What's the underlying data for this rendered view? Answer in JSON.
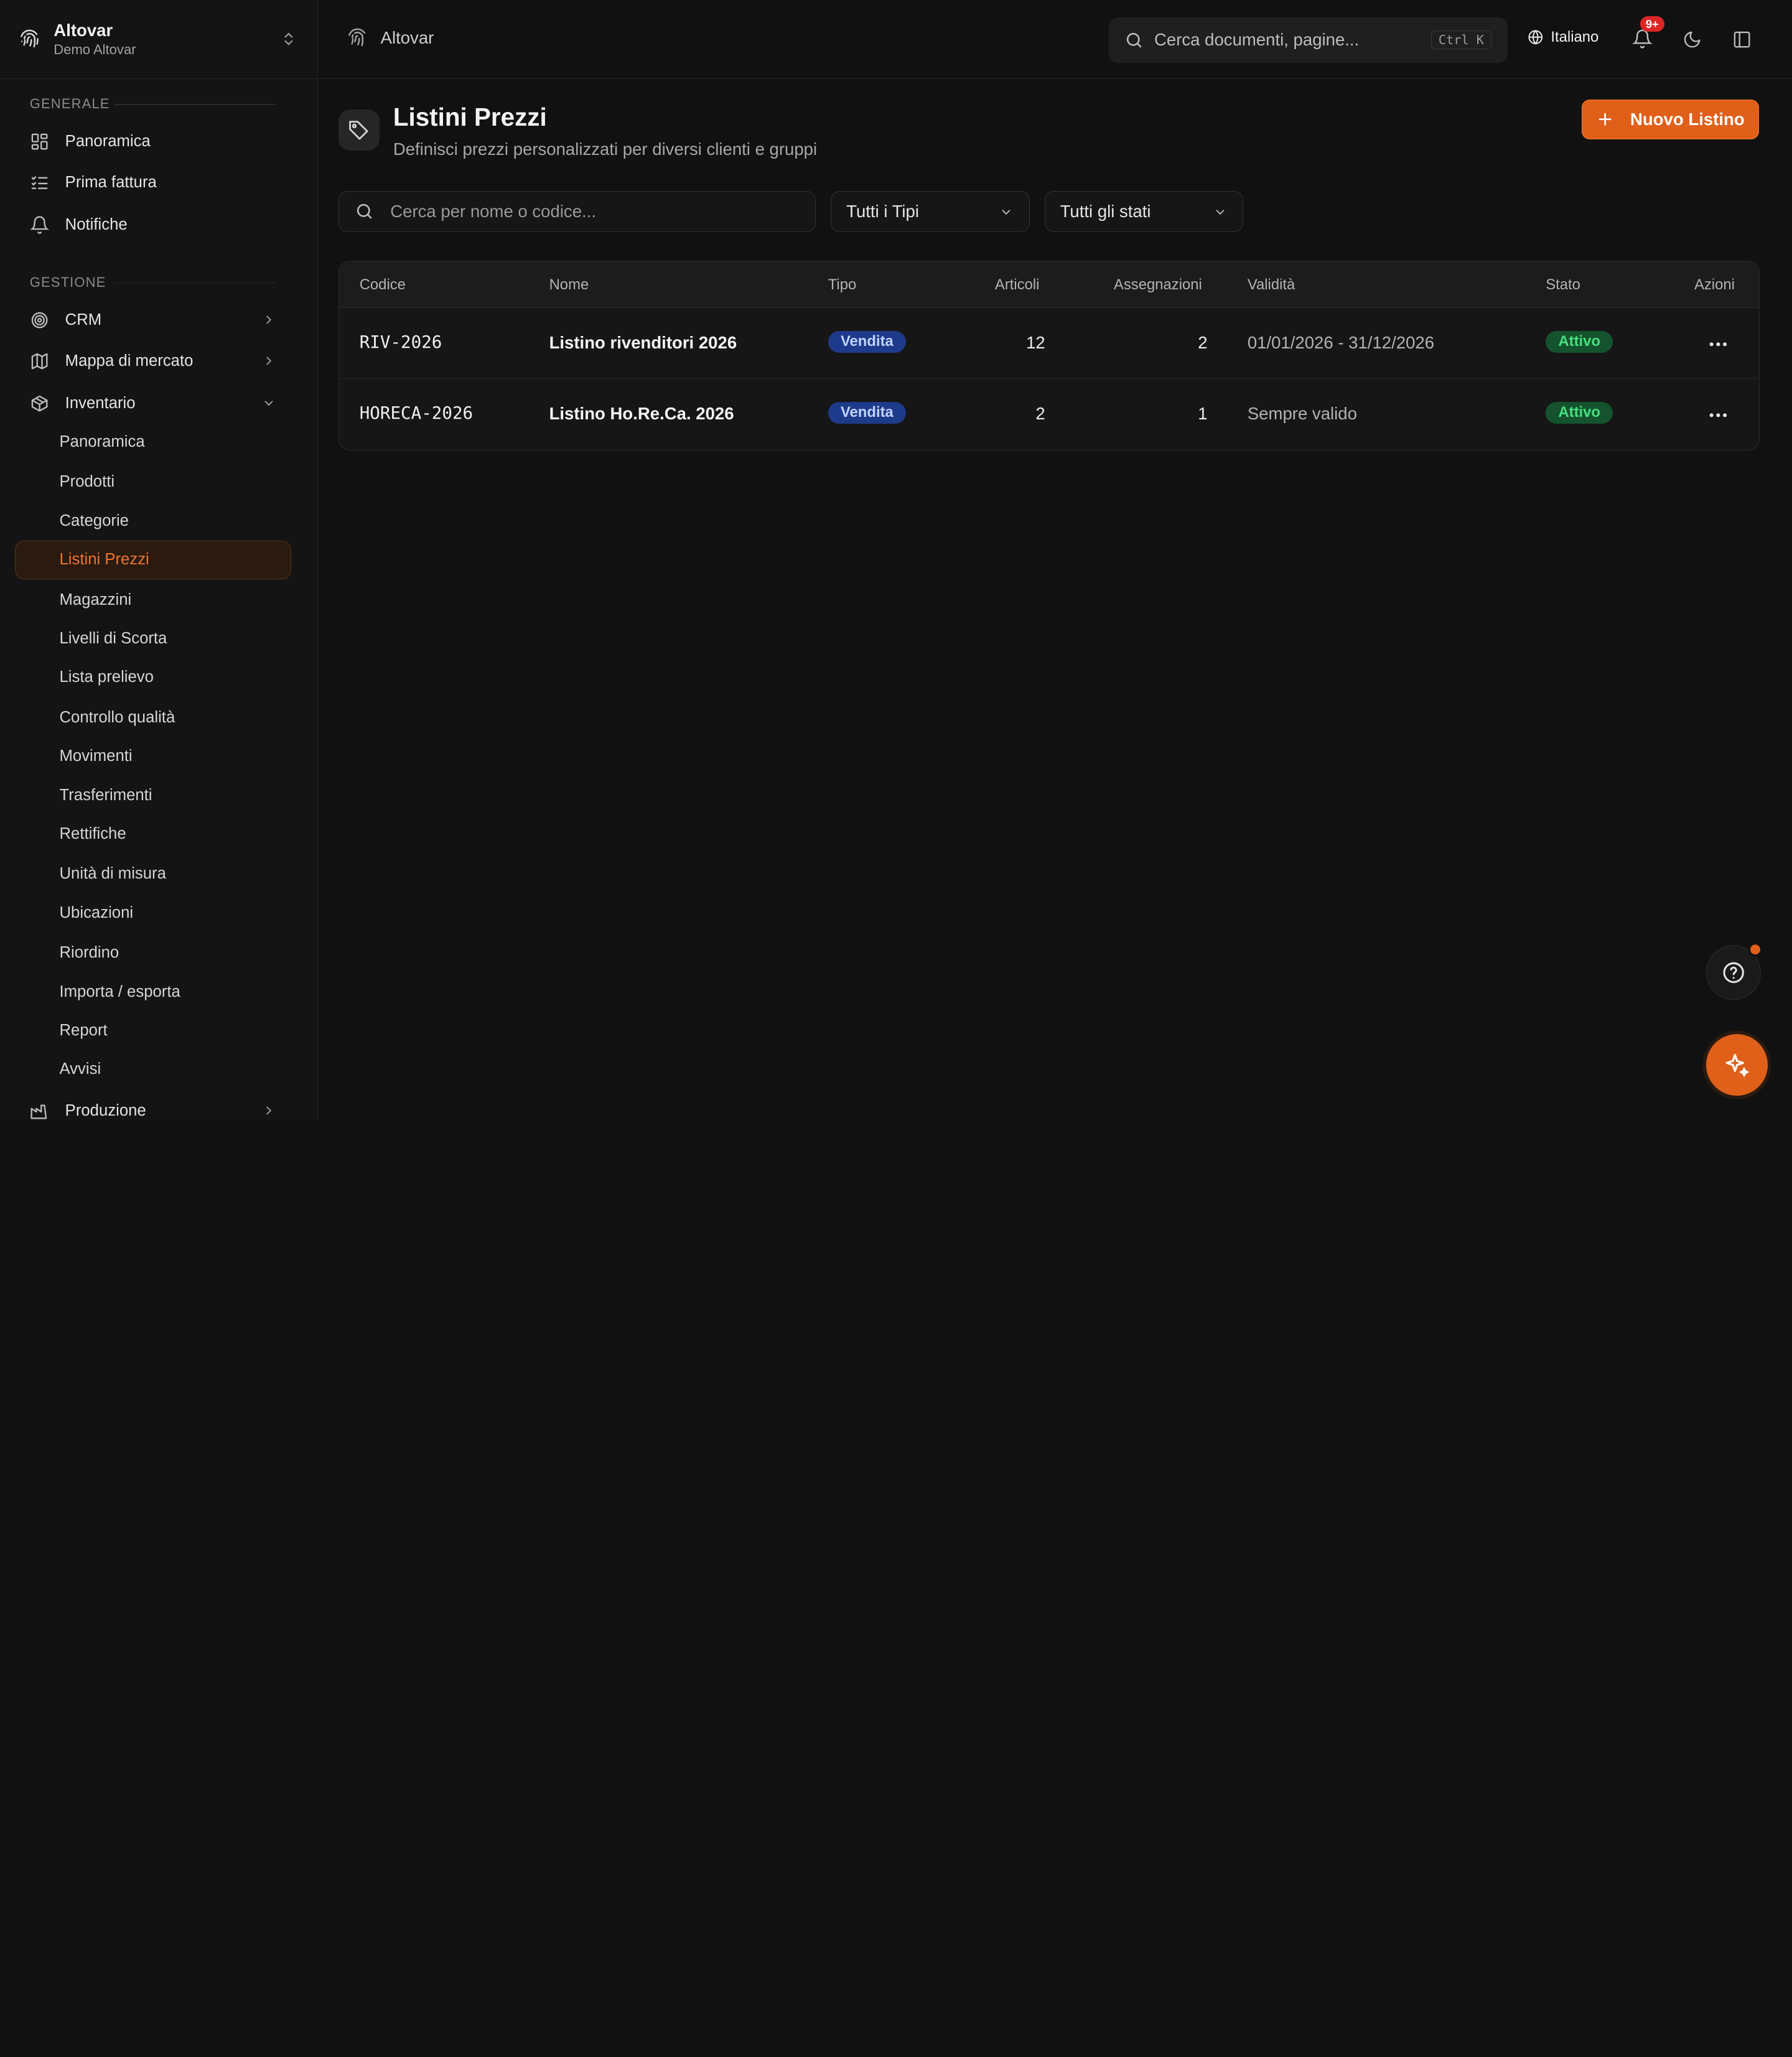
{
  "sidebar": {
    "brand_name": "Altovar",
    "brand_sub": "Demo Altovar",
    "section_general": "Generale",
    "general_items": [
      "Panoramica",
      "Prima fattura",
      "Notifiche"
    ],
    "section_management": "Gestione",
    "crm": "CRM",
    "market_map": "Mappa di mercato",
    "inventory": "Inventario",
    "inventory_items": [
      "Panoramica",
      "Prodotti",
      "Categorie",
      "Listini Prezzi",
      "Magazzini",
      "Livelli di Scorta",
      "Lista prelievo",
      "Controllo qualità",
      "Movimenti",
      "Trasferimenti",
      "Rettifiche",
      "Unità di misura",
      "Ubicazioni",
      "Riordino",
      "Importa / esporta",
      "Report",
      "Avvisi"
    ],
    "production": "Produzione"
  },
  "topbar": {
    "breadcrumb": "Altovar",
    "search_placeholder": "Cerca documenti, pagine...",
    "shortcut": "Ctrl K",
    "language": "Italiano",
    "notif_badge": "9+"
  },
  "page": {
    "title": "Listini Prezzi",
    "subtitle": "Definisci prezzi personalizzati per diversi clienti e gruppi",
    "new_button": "Nuovo Listino",
    "search_placeholder": "Cerca per nome o codice...",
    "type_filter": "Tutti i Tipi",
    "state_filter": "Tutti gli stati"
  },
  "table": {
    "headers": {
      "code": "Codice",
      "name": "Nome",
      "type": "Tipo",
      "items": "Articoli",
      "assignments": "Assegnazioni",
      "validity": "Validità",
      "state": "Stato",
      "actions": "Azioni"
    },
    "rows": [
      {
        "code": "RIV-2026",
        "name": "Listino rivenditori 2026",
        "type": "Vendita",
        "items": "12",
        "assignments": "2",
        "validity": "01/01/2026 - 31/12/2026",
        "state": "Attivo"
      },
      {
        "code": "HORECA-2026",
        "name": "Listino Ho.Re.Ca. 2026",
        "type": "Vendita",
        "items": "2",
        "assignments": "1",
        "validity": "Sempre valido",
        "state": "Attivo"
      }
    ]
  },
  "colors": {
    "accent": "#e0601a",
    "background": "#111111",
    "badge_type": "#1e3a8a",
    "badge_state": "#14532d"
  }
}
